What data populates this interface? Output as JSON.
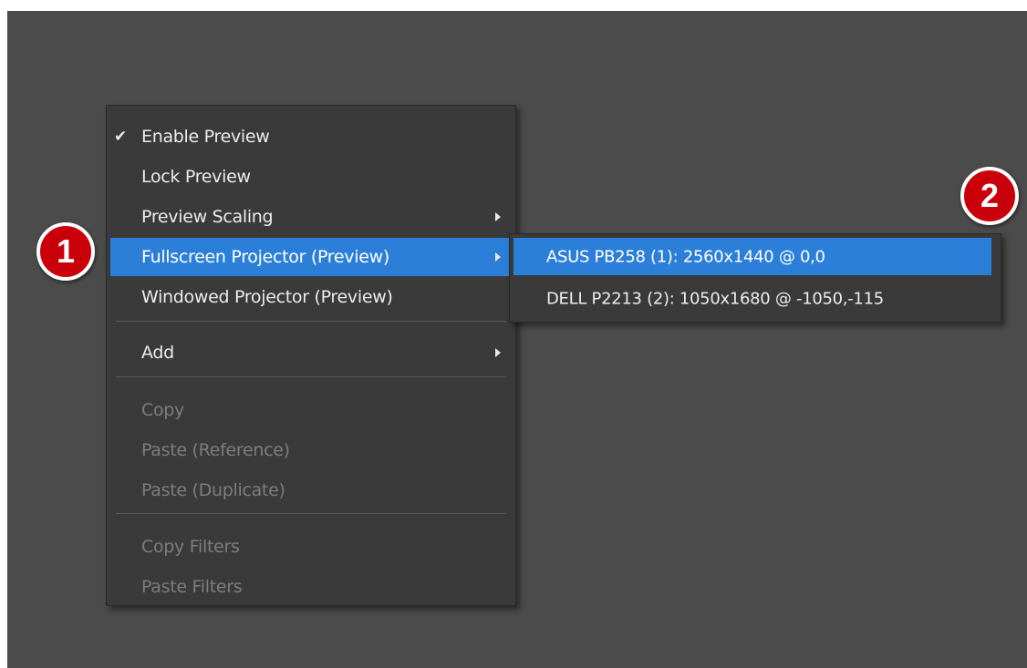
{
  "colors": {
    "backdrop": "#4b4b4b",
    "menu_bg": "#3a3a3a",
    "highlight": "#2b7fd8",
    "disabled_text": "#7d7d7d",
    "badge": "#c9000a"
  },
  "context_menu": {
    "items": [
      {
        "label": "Enable Preview",
        "checked": true
      },
      {
        "label": "Lock Preview"
      },
      {
        "label": "Preview Scaling",
        "submenu": true
      },
      {
        "label": "Fullscreen Projector (Preview)",
        "submenu": true,
        "highlighted": true
      },
      {
        "label": "Windowed Projector (Preview)"
      },
      {
        "label": "Add",
        "submenu": true
      },
      {
        "label": "Copy",
        "disabled": true
      },
      {
        "label": "Paste (Reference)",
        "disabled": true
      },
      {
        "label": "Paste (Duplicate)",
        "disabled": true
      },
      {
        "label": "Copy Filters",
        "disabled": true
      },
      {
        "label": "Paste Filters",
        "disabled": true
      }
    ]
  },
  "submenu": {
    "items": [
      {
        "label": "ASUS PB258 (1): 2560x1440 @ 0,0",
        "highlighted": true
      },
      {
        "label": "DELL P2213 (2): 1050x1680 @ -1050,-115"
      }
    ]
  },
  "icons": {
    "check": "checkmark-icon",
    "submenu_arrow": "chevron-right-icon"
  },
  "annotations": [
    {
      "label": "1"
    },
    {
      "label": "2"
    }
  ]
}
